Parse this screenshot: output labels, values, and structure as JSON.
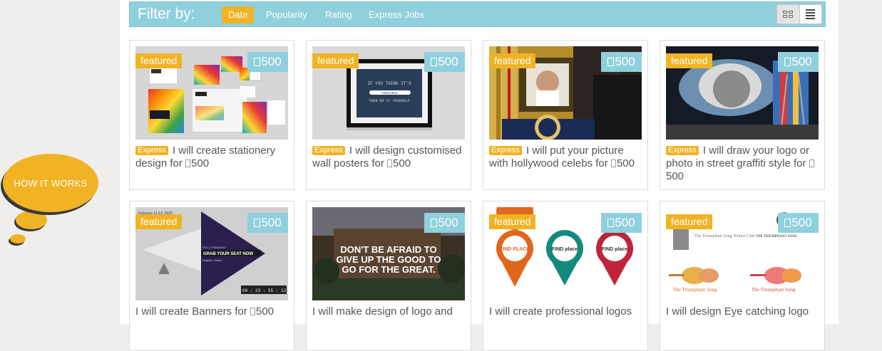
{
  "how_it_works": "HOW IT WORKS",
  "filter": {
    "title": "Filter by:",
    "tabs": [
      "Date",
      "Popularity",
      "Rating",
      "Express Jobs"
    ]
  },
  "colors": {
    "accent": "#f0b324",
    "teal": "#8fd0dc"
  },
  "gigs": [
    {
      "featured": "featured",
      "price": "500",
      "express": "Express",
      "title_text": "I will create stationery design for",
      "title_price": "500"
    },
    {
      "featured": "featured",
      "price": "500",
      "express": "Express",
      "title_text": "I will design customised wall posters for",
      "title_price": "500",
      "poster_lines": [
        "IF YOU THINK IT'S",
        "POSSIBLE",
        "THEN DO IT YOURSELF"
      ]
    },
    {
      "featured": "featured",
      "price": "500",
      "express": "Express",
      "title_text": "I will put your picture with hollywood celebs for",
      "title_price": "500"
    },
    {
      "featured": "featured",
      "price": "500",
      "express": "Express",
      "title_text": "I will draw your logo or photo in street graffiti style for",
      "title_price": "500"
    },
    {
      "featured": "featured",
      "price": "500",
      "title_text": "I will create Banners for",
      "title_price": "500",
      "banner_lines": [
        "February 11-13, 2015",
        "STILL THINKING?",
        "GRAB YOUR SEAT NOW",
        "Register Online",
        "08 : 23 : 55 : 12"
      ]
    },
    {
      "price": "500",
      "title_text": "I will make design of logo and",
      "overlay_lines": [
        "DON'T BE AFRAID TO",
        "GIVE UP THE GOOD TO",
        "GO FOR THE GREAT."
      ]
    },
    {
      "featured": "featured",
      "price": "500",
      "title_text": "I will create professional logos",
      "pins": [
        "FIND PLACE",
        "FIND place",
        "FIND place"
      ]
    },
    {
      "featured": "featured",
      "price": "500",
      "title_text": "I will design Eye catching logo",
      "logo_lines": [
        "The Triumphant Song Writers Club",
        "THE TRIUMPHANT SONG",
        "The Triumphant Song",
        "The Triumphant Song"
      ]
    }
  ]
}
